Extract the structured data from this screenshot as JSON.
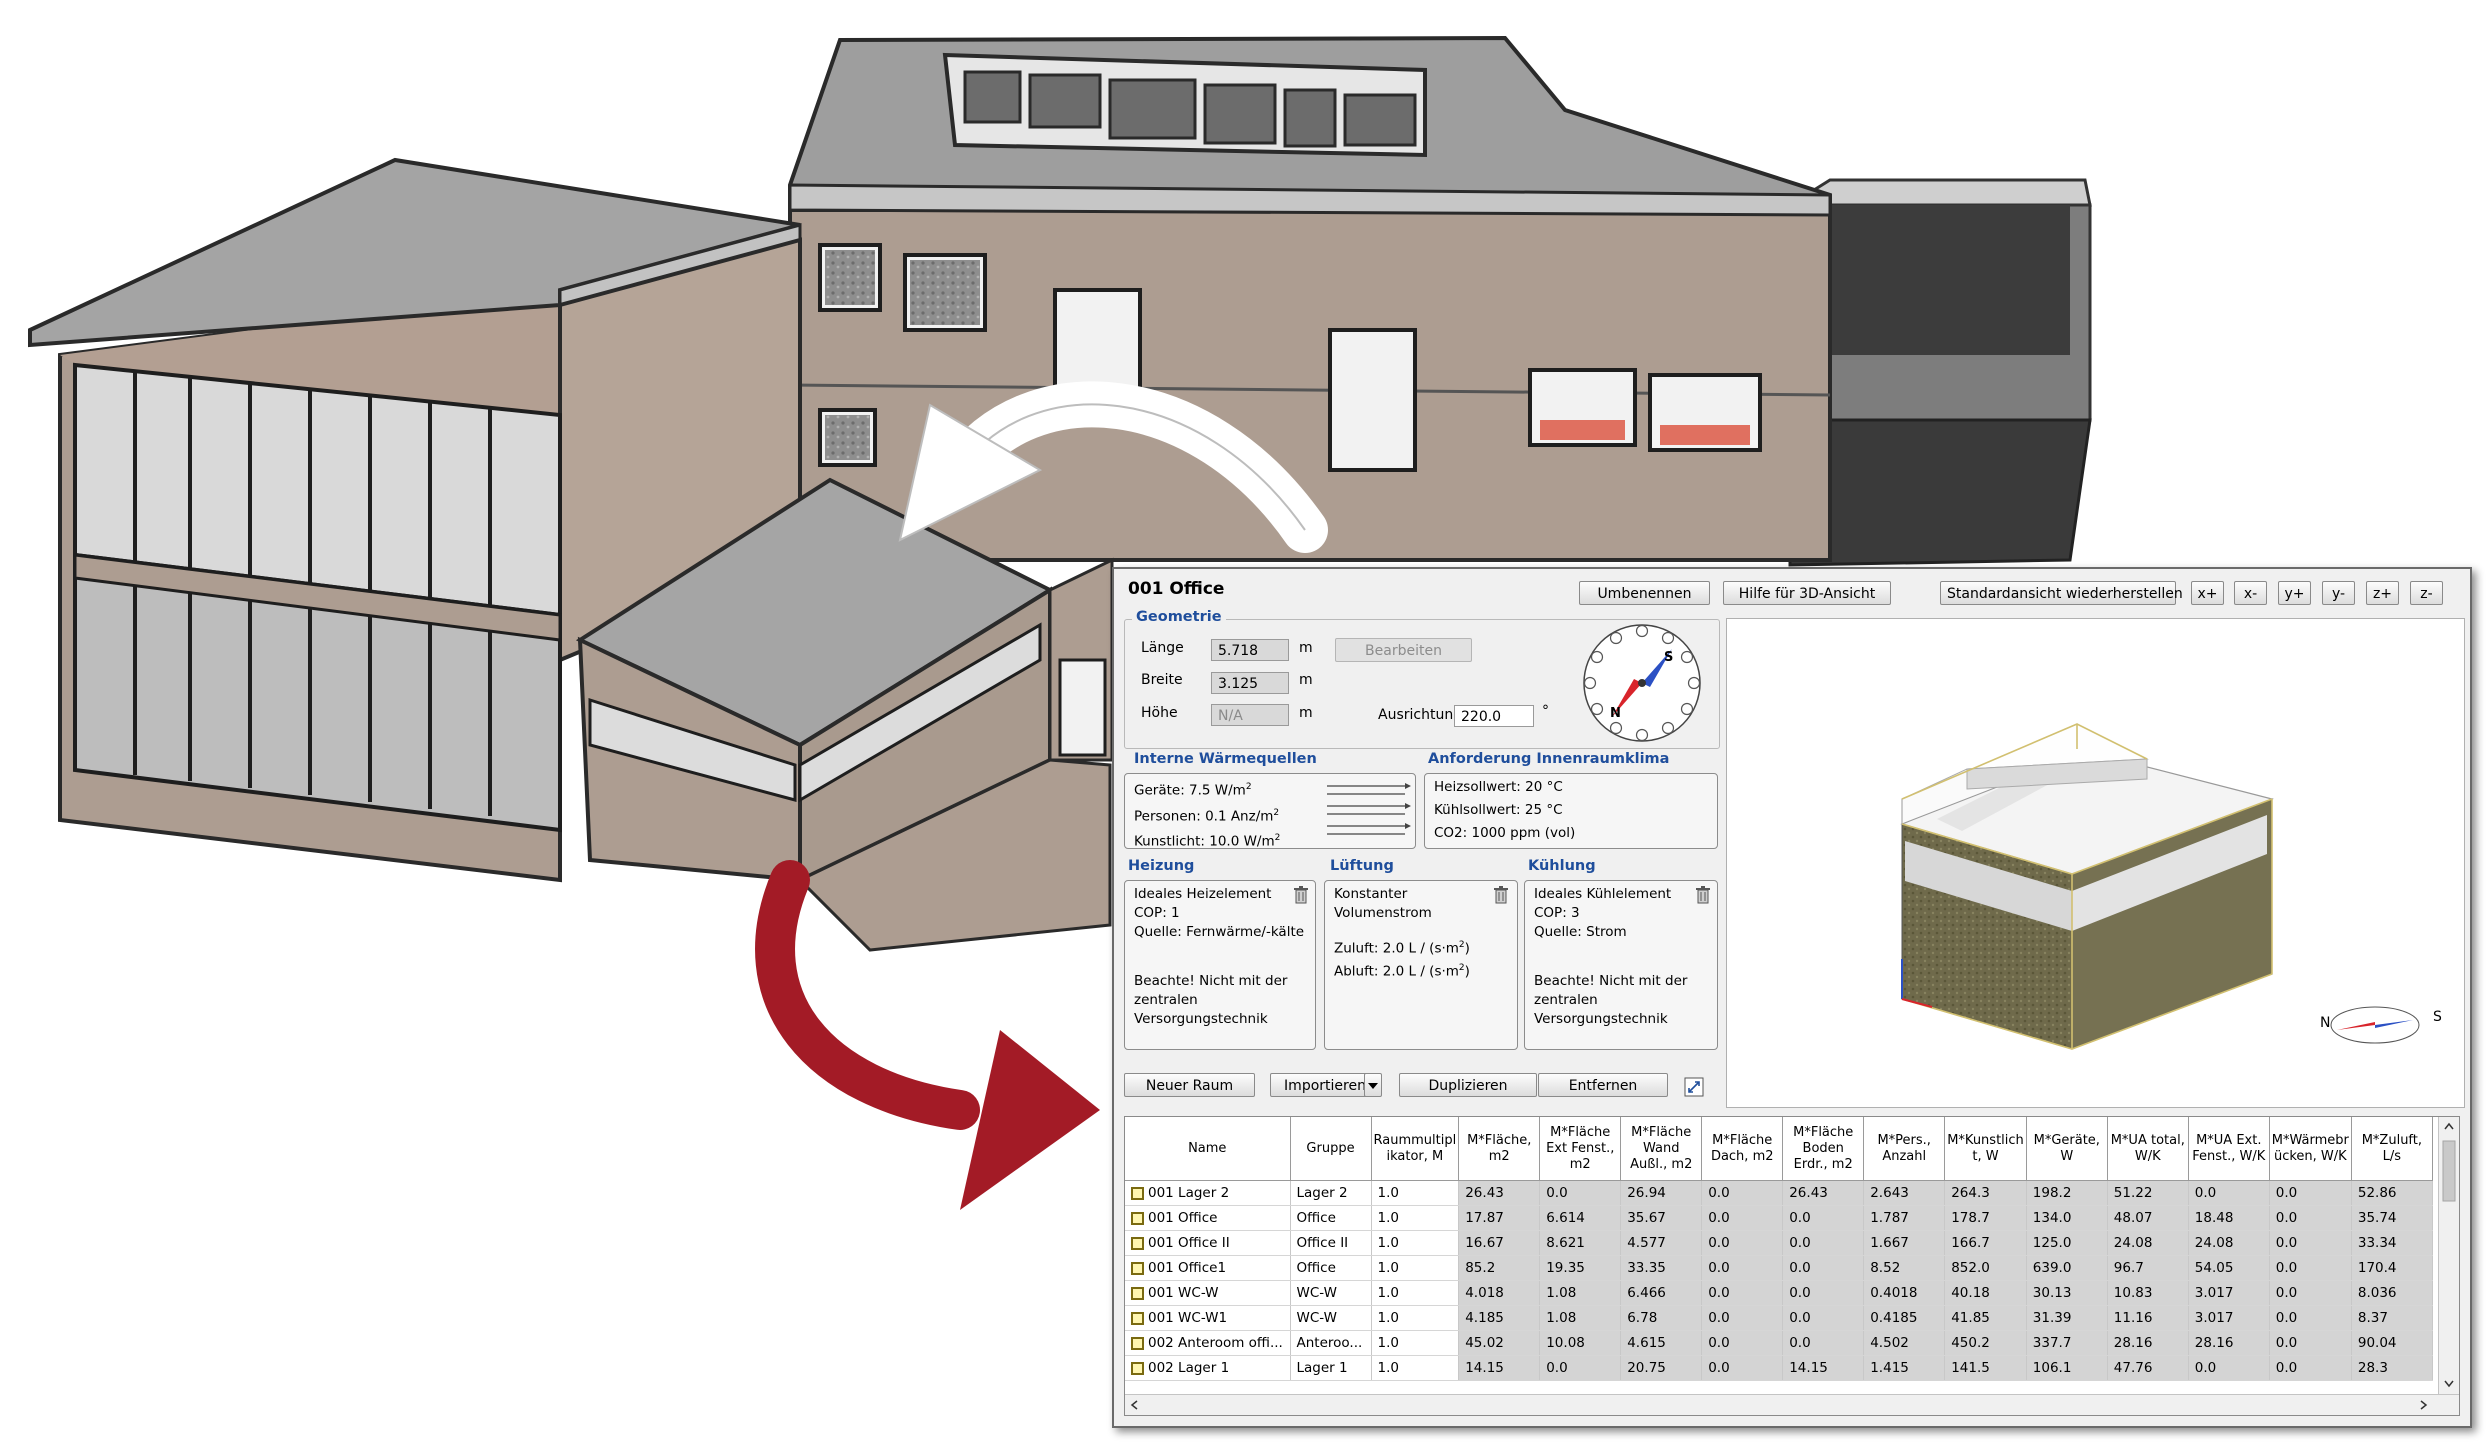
{
  "panel": {
    "room_title": "001 Office",
    "buttons": {
      "rename": "Umbenennen",
      "help3d": "Hilfe für 3D-Ansicht",
      "reset_view": "Standardansicht wiederherstellen",
      "xplus": "x+",
      "xminus": "x-",
      "yplus": "y+",
      "yminus": "y-",
      "zplus": "z+",
      "zminus": "z-"
    },
    "geometry": {
      "title": "Geometrie",
      "length_label": "Länge",
      "length_value": "5.718",
      "length_unit": "m",
      "width_label": "Breite",
      "width_value": "3.125",
      "width_unit": "m",
      "height_label": "Höhe",
      "height_value": "N/A",
      "height_unit": "m",
      "edit_button": "Bearbeiten",
      "orientation_label": "Ausrichtung",
      "orientation_value": "220.0",
      "orientation_unit": "°",
      "compass_s": "S",
      "compass_n": "N"
    },
    "internal_gains": {
      "title": "Interne Wärmequellen",
      "devices": "Geräte: 7.5 W/m",
      "devices_sup": "2",
      "persons": "Personen: 0.1 Anz/m",
      "persons_sup": "2",
      "lighting": "Kunstlicht: 10.0 W/m",
      "lighting_sup": "2"
    },
    "climate": {
      "title": "Anforderung Innenraumklima",
      "heating_setpoint": "Heizsollwert: 20 °C",
      "cooling_setpoint": "Kühlsollwert: 25 °C",
      "co2": "CO2: 1000 ppm (vol)"
    },
    "heating": {
      "title": "Heizung",
      "l1": "Ideales Heizelement",
      "l2": "COP: 1",
      "l3": "Quelle: Fernwärme/-kälte",
      "n1": "Beachte! Nicht mit der",
      "n2": "zentralen",
      "n3": "Versorgungstechnik"
    },
    "ventilation": {
      "title": "Lüftung",
      "l1": "Konstanter",
      "l2": "Volumenstrom",
      "supply": "Zuluft: 2.0 L / (s·m",
      "supply_sup": "2",
      "supply_end": ")",
      "exhaust": "Abluft: 2.0 L / (s·m",
      "exhaust_sup": "2",
      "exhaust_end": ")"
    },
    "cooling": {
      "title": "Kühlung",
      "l1": "Ideales Kühlelement",
      "l2": "COP: 3",
      "l3": "Quelle: Strom",
      "n1": "Beachte! Nicht mit der",
      "n2": "zentralen",
      "n3": "Versorgungstechnik"
    },
    "actions": {
      "new_room": "Neuer Raum",
      "import": "Importieren",
      "duplicate": "Duplizieren",
      "remove": "Entfernen"
    },
    "view_compass": {
      "n": "N",
      "s": "S"
    }
  },
  "table": {
    "headers": [
      "Name",
      "Gruppe",
      "Raummultipl ikator, M",
      "M*Fläche, m2",
      "M*Fläche Ext Fenst., m2",
      "M*Fläche Wand Außl., m2",
      "M*Fläche Dach, m2",
      "M*Fläche Boden Erdr., m2",
      "M*Pers., Anzahl",
      "M*Kunstlich t, W",
      "M*Geräte, W",
      "M*UA total, W/K",
      "M*UA Ext. Fenst., W/K",
      "M*Wärmebr ücken, W/K",
      "M*Zuluft, L/s"
    ],
    "rows": [
      [
        "001 Lager 2",
        "Lager 2",
        "1.0",
        "26.43",
        "0.0",
        "26.94",
        "0.0",
        "26.43",
        "2.643",
        "264.3",
        "198.2",
        "51.22",
        "0.0",
        "0.0",
        "52.86"
      ],
      [
        "001 Office",
        "Office",
        "1.0",
        "17.87",
        "6.614",
        "35.67",
        "0.0",
        "0.0",
        "1.787",
        "178.7",
        "134.0",
        "48.07",
        "18.48",
        "0.0",
        "35.74"
      ],
      [
        "001 Office II",
        "Office II",
        "1.0",
        "16.67",
        "8.621",
        "4.577",
        "0.0",
        "0.0",
        "1.667",
        "166.7",
        "125.0",
        "24.08",
        "24.08",
        "0.0",
        "33.34"
      ],
      [
        "001 Office1",
        "Office",
        "1.0",
        "85.2",
        "19.35",
        "33.35",
        "0.0",
        "0.0",
        "8.52",
        "852.0",
        "639.0",
        "96.7",
        "54.05",
        "0.0",
        "170.4"
      ],
      [
        "001 WC-W",
        "WC-W",
        "1.0",
        "4.018",
        "1.08",
        "6.466",
        "0.0",
        "0.0",
        "0.4018",
        "40.18",
        "30.13",
        "10.83",
        "3.017",
        "0.0",
        "8.036"
      ],
      [
        "001 WC-W1",
        "WC-W",
        "1.0",
        "4.185",
        "1.08",
        "6.78",
        "0.0",
        "0.0",
        "0.4185",
        "41.85",
        "31.39",
        "11.16",
        "3.017",
        "0.0",
        "8.37"
      ],
      [
        "002 Anteroom offi...",
        "Anteroo...",
        "1.0",
        "45.02",
        "10.08",
        "4.615",
        "0.0",
        "0.0",
        "4.502",
        "450.2",
        "337.7",
        "28.16",
        "28.16",
        "0.0",
        "90.04"
      ],
      [
        "002 Lager 1",
        "Lager 1",
        "1.0",
        "14.15",
        "0.0",
        "20.75",
        "0.0",
        "14.15",
        "1.415",
        "141.5",
        "106.1",
        "47.76",
        "0.0",
        "0.0",
        "28.3"
      ]
    ]
  },
  "colors": {
    "accent_blue": "#1f4e9c",
    "arrow_red": "#a31b26",
    "facade": "#ad9d91",
    "roof": "#a4a4a4"
  }
}
